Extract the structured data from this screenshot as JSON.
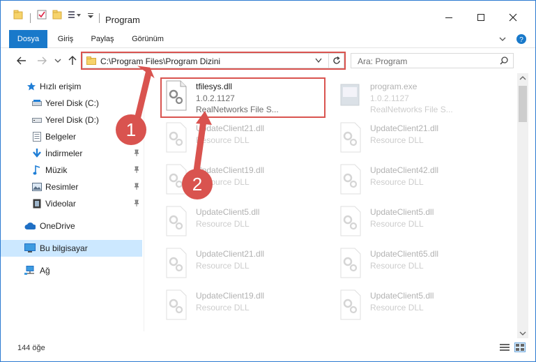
{
  "window": {
    "title": "Program"
  },
  "ribbon": {
    "tabs": [
      "Dosya",
      "Giriş",
      "Paylaş",
      "Görünüm"
    ]
  },
  "nav": {
    "address": "C:\\Program Files\\Program Dizini",
    "search_placeholder": "Ara: Program"
  },
  "sidebar": {
    "items": [
      {
        "label": "Hızlı erişim",
        "icon": "star-icon"
      },
      {
        "label": "Yerel Disk (C:)",
        "icon": "drive-icon"
      },
      {
        "label": "Yerel Disk (D:)",
        "icon": "drive-icon"
      },
      {
        "label": "Belgeler",
        "icon": "document-icon"
      },
      {
        "label": "İndirmeler",
        "icon": "download-icon",
        "pinned": true
      },
      {
        "label": "Müzik",
        "icon": "music-icon",
        "pinned": true
      },
      {
        "label": "Resimler",
        "icon": "pictures-icon",
        "pinned": true
      },
      {
        "label": "Videolar",
        "icon": "video-icon",
        "pinned": true
      },
      {
        "label": "OneDrive",
        "icon": "cloud-icon"
      },
      {
        "label": "Bu bilgisayar",
        "icon": "computer-icon",
        "selected": true
      },
      {
        "label": "Ağ",
        "icon": "network-icon"
      }
    ]
  },
  "files": {
    "highlighted": {
      "name": "tfilesys.dll",
      "version": "1.0.2.1127",
      "desc": "RealNetworks File S..."
    },
    "program": {
      "name": "program.exe",
      "version": "1.0.2.1127",
      "desc": "RealNetworks File S..."
    },
    "grid": [
      {
        "name": "UpdateClient21.dll",
        "desc": "Resource DLL"
      },
      {
        "name": "UpdateClient21.dll",
        "desc": "Resource DLL"
      },
      {
        "name": "UpdateClient19.dll",
        "desc": "Resource DLL"
      },
      {
        "name": "UpdateClient42.dll",
        "desc": "Resource DLL"
      },
      {
        "name": "UpdateClient5.dll",
        "desc": "Resource DLL"
      },
      {
        "name": "UpdateClient5.dll",
        "desc": "Resource DLL"
      },
      {
        "name": "UpdateClient21.dll",
        "desc": "Resource DLL"
      },
      {
        "name": "UpdateClient65.dll",
        "desc": "Resource DLL"
      },
      {
        "name": "UpdateClient19.dll",
        "desc": "Resource DLL"
      },
      {
        "name": "UpdateClient5.dll",
        "desc": "Resource DLL"
      }
    ]
  },
  "status": {
    "count": "144 öğe"
  },
  "annotations": [
    "1",
    "2"
  ],
  "colors": {
    "accent": "#1979ca",
    "highlight": "#d9534f",
    "selected": "#cce8ff"
  }
}
